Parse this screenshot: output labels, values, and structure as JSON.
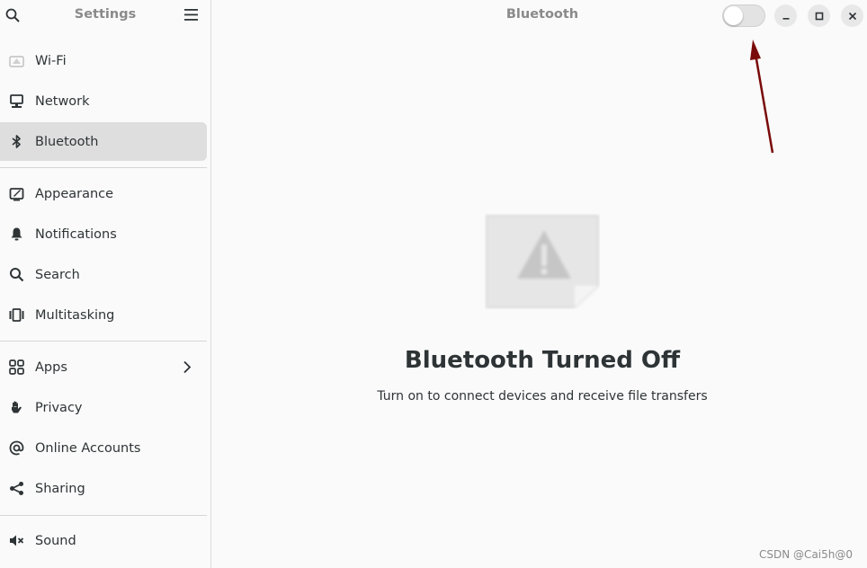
{
  "sidebar": {
    "title": "Settings",
    "items": [
      {
        "label": "Wi-Fi",
        "icon": "wifi-icon"
      },
      {
        "label": "Network",
        "icon": "network-icon"
      },
      {
        "label": "Bluetooth",
        "icon": "bluetooth-icon",
        "selected": true
      },
      {
        "label": "Appearance",
        "icon": "appearance-icon"
      },
      {
        "label": "Notifications",
        "icon": "bell-icon"
      },
      {
        "label": "Search",
        "icon": "search-icon"
      },
      {
        "label": "Multitasking",
        "icon": "multitasking-icon"
      },
      {
        "label": "Apps",
        "icon": "apps-grid-icon"
      },
      {
        "label": "Privacy",
        "icon": "hand-icon"
      },
      {
        "label": "Online Accounts",
        "icon": "at-sign-icon"
      },
      {
        "label": "Sharing",
        "icon": "share-icon"
      },
      {
        "label": "Sound",
        "icon": "speaker-icon"
      }
    ]
  },
  "header": {
    "title": "Bluetooth",
    "toggle_on": false
  },
  "status": {
    "icon": "bluetooth-warning-image",
    "title": "Bluetooth Turned Off",
    "description": "Turn on to connect devices and receive file transfers"
  },
  "annotation": {
    "arrow_color": "#7a0a0a"
  },
  "watermark": "CSDN @Cai5h@0",
  "colors": {
    "selected_bg": "#dedede",
    "window_bg": "#fafafa"
  }
}
